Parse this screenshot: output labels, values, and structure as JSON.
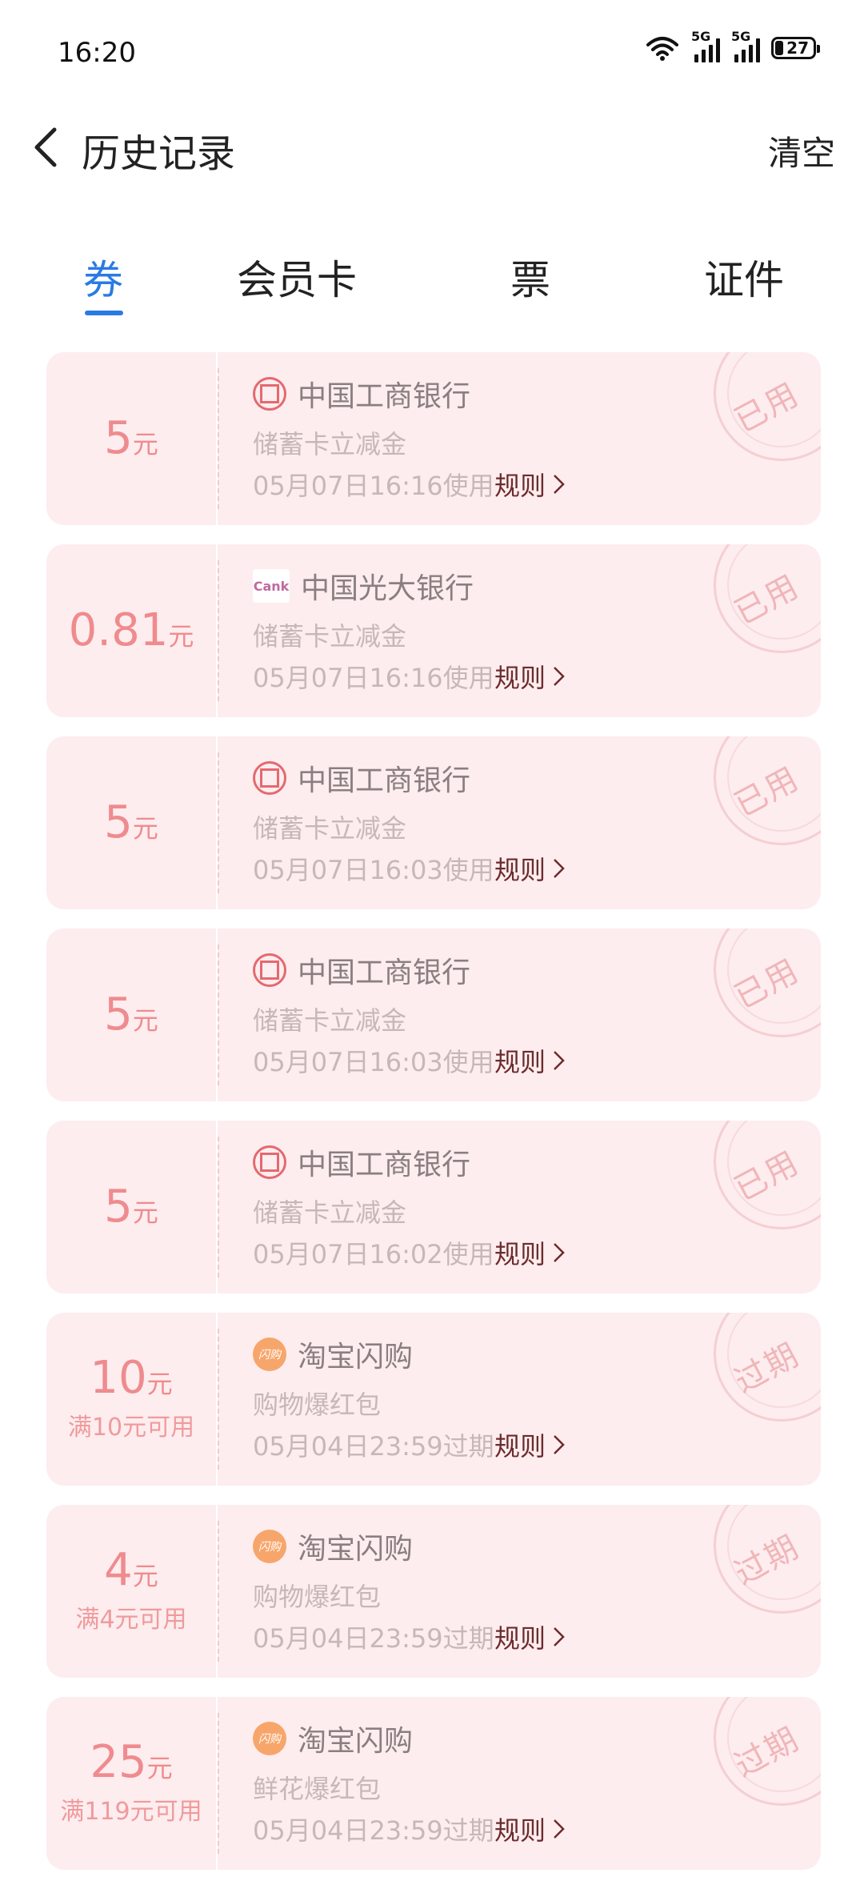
{
  "status_bar": {
    "time": "16:20",
    "signal1_label": "5G",
    "signal2_label": "5G",
    "battery": "27"
  },
  "header": {
    "title": "历史记录",
    "clear_label": "清空"
  },
  "tabs": [
    {
      "label": "券",
      "active": true
    },
    {
      "label": "会员卡",
      "active": false
    },
    {
      "label": "票",
      "active": false
    },
    {
      "label": "证件",
      "active": false
    }
  ],
  "coupons": [
    {
      "amount": "5",
      "unit": "元",
      "condition": "",
      "merchant": "中国工商银行",
      "logo": "icbc-logo-icon",
      "desc": "储蓄卡立减金",
      "meta": "05月07日16:16使用",
      "rule_label": "规则",
      "stamp": "已用"
    },
    {
      "amount": "0.81",
      "unit": "元",
      "condition": "",
      "merchant": "中国光大银行",
      "logo": "ceb-logo-icon",
      "logo_text": "Cank",
      "desc": "储蓄卡立减金",
      "meta": "05月07日16:16使用",
      "rule_label": "规则",
      "stamp": "已用"
    },
    {
      "amount": "5",
      "unit": "元",
      "condition": "",
      "merchant": "中国工商银行",
      "logo": "icbc-logo-icon",
      "desc": "储蓄卡立减金",
      "meta": "05月07日16:03使用",
      "rule_label": "规则",
      "stamp": "已用"
    },
    {
      "amount": "5",
      "unit": "元",
      "condition": "",
      "merchant": "中国工商银行",
      "logo": "icbc-logo-icon",
      "desc": "储蓄卡立减金",
      "meta": "05月07日16:03使用",
      "rule_label": "规则",
      "stamp": "已用"
    },
    {
      "amount": "5",
      "unit": "元",
      "condition": "",
      "merchant": "中国工商银行",
      "logo": "icbc-logo-icon",
      "desc": "储蓄卡立减金",
      "meta": "05月07日16:02使用",
      "rule_label": "规则",
      "stamp": "已用"
    },
    {
      "amount": "10",
      "unit": "元",
      "condition": "满10元可用",
      "merchant": "淘宝闪购",
      "logo": "taobao-logo-icon",
      "logo_text": "闪购",
      "desc": "购物爆红包",
      "meta": "05月04日23:59过期",
      "rule_label": "规则",
      "stamp": "过期"
    },
    {
      "amount": "4",
      "unit": "元",
      "condition": "满4元可用",
      "merchant": "淘宝闪购",
      "logo": "taobao-logo-icon",
      "logo_text": "闪购",
      "desc": "购物爆红包",
      "meta": "05月04日23:59过期",
      "rule_label": "规则",
      "stamp": "过期"
    },
    {
      "amount": "25",
      "unit": "元",
      "condition": "满119元可用",
      "merchant": "淘宝闪购",
      "logo": "taobao-logo-icon",
      "logo_text": "闪购",
      "desc": "鲜花爆红包",
      "meta": "05月04日23:59过期",
      "rule_label": "规则",
      "stamp": "过期"
    }
  ],
  "colors": {
    "accent": "#2a7ae4",
    "card_bg": "#fdedee",
    "amount": "#ef8b8f",
    "rule": "#6b2b2d"
  }
}
